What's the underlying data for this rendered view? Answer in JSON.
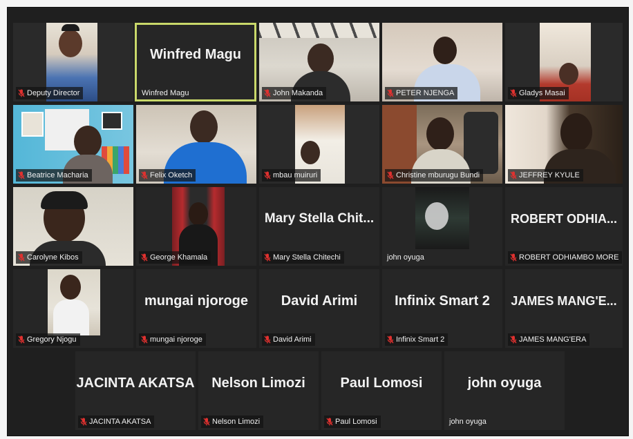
{
  "colors": {
    "muted_mic": "#e0312f",
    "active_speaker_border": "#c9d86a",
    "tile_background": "#262626",
    "stage_background": "#1f1f1f"
  },
  "participants": [
    {
      "name": "Deputy Director",
      "label": "Deputy Director",
      "muted": true,
      "video": true
    },
    {
      "name": "Winfred Magu",
      "label": "Winfred Magu",
      "muted": false,
      "video": false,
      "active_speaker": true
    },
    {
      "name": "John Makanda",
      "label": "John Makanda",
      "muted": true,
      "video": true
    },
    {
      "name": "PETER NJENGA",
      "label": "PETER NJENGA",
      "muted": true,
      "video": true
    },
    {
      "name": "Gladys Masai",
      "label": "Gladys Masai",
      "muted": true,
      "video": true
    },
    {
      "name": "Beatrice Macharia",
      "label": "Beatrice Macharia",
      "muted": true,
      "video": true
    },
    {
      "name": "Felix Oketch",
      "label": "Felix Oketch",
      "muted": true,
      "video": true
    },
    {
      "name": "mbau muiruri",
      "label": "mbau muiruri",
      "muted": true,
      "video": true
    },
    {
      "name": "Christine mburugu Bundi",
      "label": "Christine mburugu Bundi",
      "muted": true,
      "video": true
    },
    {
      "name": "JEFFREY KYULE",
      "label": "JEFFREY KYULE",
      "muted": true,
      "video": true
    },
    {
      "name": "Carolyne Kibos",
      "label": "Carolyne Kibos",
      "muted": true,
      "video": true
    },
    {
      "name": "George Khamala",
      "label": "George Khamala",
      "muted": true,
      "video": true
    },
    {
      "name": "Mary Stella Chit...",
      "label": "Mary Stella Chitechi",
      "muted": true,
      "video": false
    },
    {
      "name": "john oyuga",
      "label": "john oyuga",
      "muted": false,
      "video": true
    },
    {
      "name": "ROBERT  ODHIA...",
      "label": "ROBERT ODHIAMBO MORE",
      "muted": true,
      "video": false
    },
    {
      "name": "Gregory Njogu",
      "label": "Gregory Njogu",
      "muted": true,
      "video": true
    },
    {
      "name": "mungai njoroge",
      "label": "mungai njoroge",
      "muted": true,
      "video": false
    },
    {
      "name": "David Arimi",
      "label": "David Arimi",
      "muted": true,
      "video": false
    },
    {
      "name": "Infinix Smart 2",
      "label": "Infinix Smart 2",
      "muted": true,
      "video": false
    },
    {
      "name": "JAMES  MANG'E...",
      "label": "JAMES MANG'ERA",
      "muted": true,
      "video": false
    },
    {
      "name": "JACINTA AKATSA",
      "label": "JACINTA AKATSA",
      "muted": true,
      "video": false
    },
    {
      "name": "Nelson Limozi",
      "label": "Nelson Limozi",
      "muted": true,
      "video": false
    },
    {
      "name": "Paul Lomosi",
      "label": "Paul Lomosi",
      "muted": true,
      "video": false
    },
    {
      "name": "john oyuga",
      "label": "john oyuga",
      "muted": false,
      "video": false
    }
  ]
}
